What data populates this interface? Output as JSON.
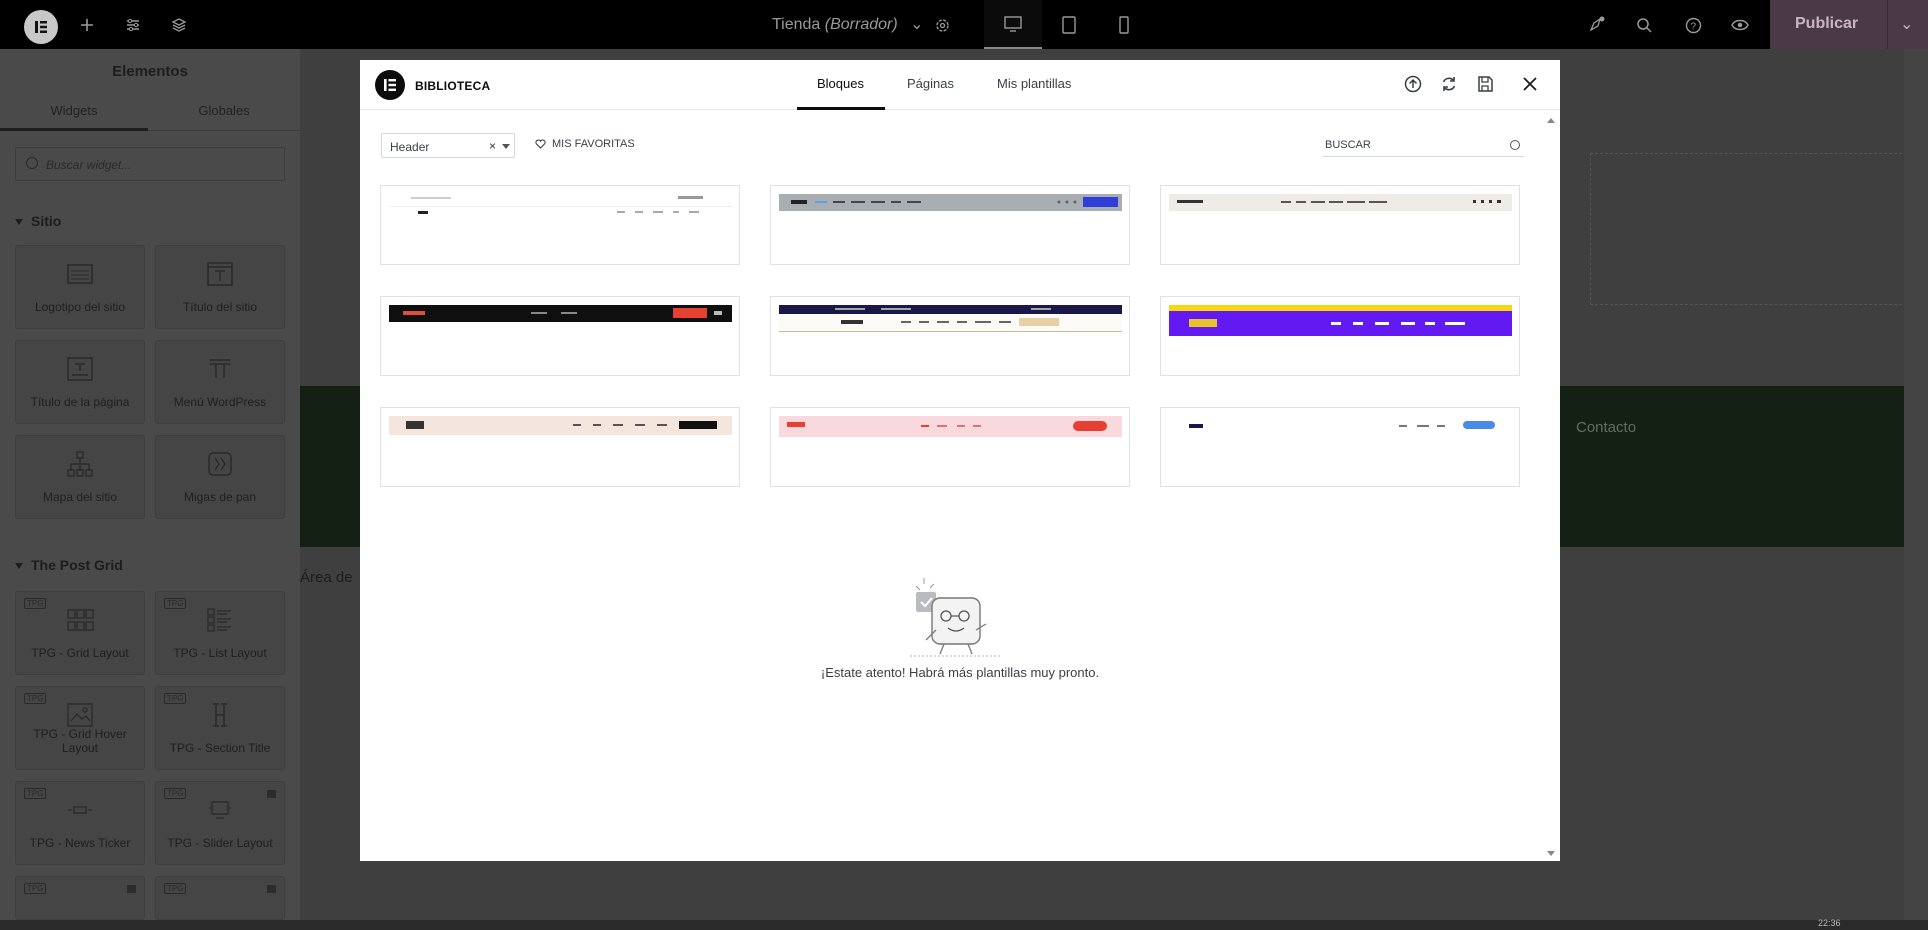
{
  "topbar": {
    "doc_title": "Tienda",
    "doc_status": "(Borrador)",
    "publish_label": "Publicar"
  },
  "panel": {
    "title": "Elementos",
    "tabs": [
      "Widgets",
      "Globales"
    ],
    "search_placeholder": "Buscar widget...",
    "section_sitio": "Sitio",
    "section_postgrid": "The Post Grid",
    "widgets_sitio": [
      "Logotipo del sitio",
      "Título del sitio",
      "Título de la página",
      "Menú WordPress",
      "Mapa del sitio",
      "Migas de pan"
    ],
    "widgets_postgrid": [
      "TPG - Grid Layout",
      "TPG - List Layout",
      "TPG - Grid Hover Layout",
      "TPG - Section Title",
      "TPG - News Ticker",
      "TPG - Slider Layout"
    ],
    "tpg_badge": "TPG"
  },
  "canvas": {
    "contacto": "Contacto",
    "area_text": "Área de"
  },
  "modal": {
    "title": "BIBLIOTECA",
    "tabs": [
      "Bloques",
      "Páginas",
      "Mis plantillas"
    ],
    "filter_value": "Header",
    "favorites_label": "MIS FAVORITAS",
    "search_placeholder": "BUSCAR",
    "empty_message": "¡Estate atento! Habrá más plantillas muy pronto."
  },
  "colors": {
    "accent_blue": "#2f3ed9",
    "purple_header": "#6219f2",
    "yellow_bar": "#f7d614",
    "red_cta": "#e64032",
    "pink_header": "#f9d9de"
  },
  "taskbar": {
    "time": "22:36"
  }
}
